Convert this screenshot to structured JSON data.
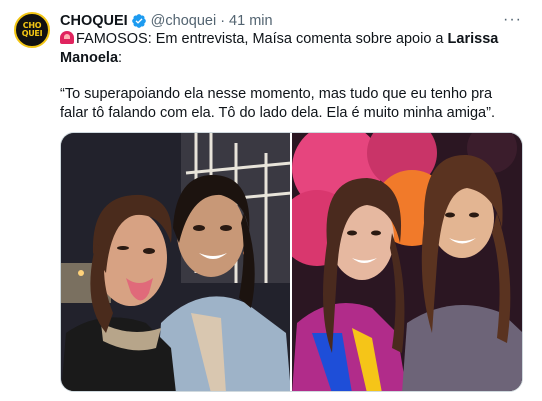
{
  "tweet": {
    "avatar_text_top": "CHO",
    "avatar_text_bottom": "QUEI",
    "author_name": "CHOQUEI",
    "handle": "@choquei",
    "separator": "·",
    "time": "41 min",
    "more_label": "···",
    "text_prefix": "FAMOSOS: Em entrevista, Maísa comenta sobre apoio a ",
    "text_bold": "Larissa Manoela",
    "text_suffix": ":",
    "quote": "“To superapoiando ela nesse momento, mas tudo que eu tenho pra falar tô falando com ela. Tô do lado dela. Ela é muito minha amiga”."
  },
  "colors": {
    "verified": "#1d9bf0",
    "siren": "#e0245e",
    "avatar_accent": "#f3c614"
  },
  "icons": {
    "verified": "verified-badge-icon",
    "siren": "siren-icon",
    "more": "more-icon"
  }
}
